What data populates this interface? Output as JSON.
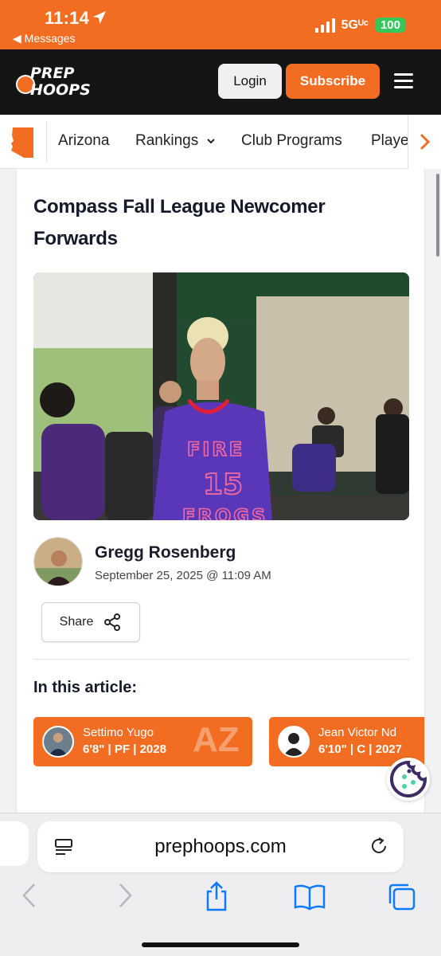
{
  "status_bar": {
    "time": "11:14",
    "back_label": "◀ Messages",
    "network": "5Gᵁᶜ",
    "battery": "100"
  },
  "header": {
    "logo_line1": "PREP",
    "logo_line2": "HOOPS",
    "login_label": "Login",
    "subscribe_label": "Subscribe"
  },
  "subnav": {
    "items": [
      "Arizona",
      "Rankings",
      "Club Programs",
      "Playe"
    ]
  },
  "article": {
    "title": "Compass Fall League Newcomer Forwards",
    "hero_jersey_line1": "FIRE",
    "hero_jersey_number": "15",
    "hero_jersey_line2": "FROGS",
    "author": "Gregg Rosenberg",
    "date": "September 25, 2025 @ 11:09 AM",
    "share_label": "Share",
    "in_article_heading": "In this article:",
    "players": [
      {
        "name": "Settimo Yugo",
        "info": "6'8\" | PF | 2028",
        "state": "AZ"
      },
      {
        "name": "Jean Victor Nd",
        "info": "6'10\" | C | 2027",
        "state": ""
      }
    ]
  },
  "browser": {
    "url": "prephoops.com"
  },
  "colors": {
    "brand_orange": "#f26d22",
    "header_dark": "#151515",
    "battery_green": "#34c759",
    "ios_blue": "#0a7aff"
  }
}
